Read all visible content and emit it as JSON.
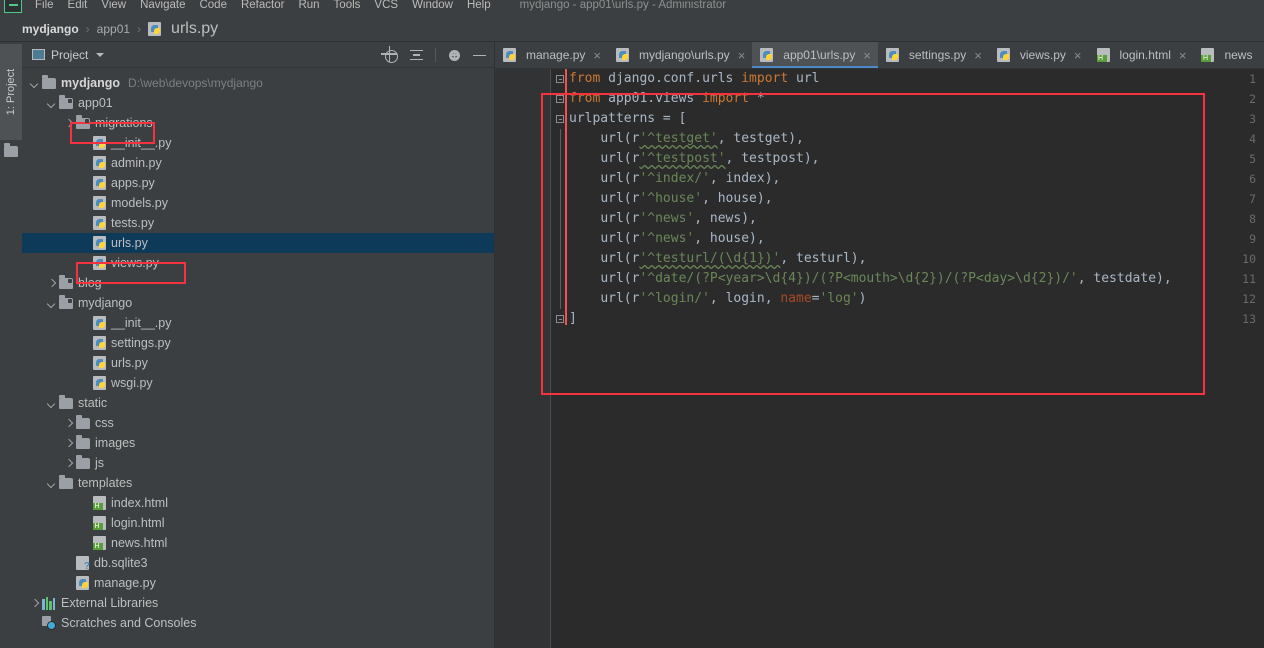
{
  "window": {
    "title": "mydjango - app01\\urls.py - Administrator",
    "app_icon": "pycharm-icon"
  },
  "menubar": {
    "items": [
      "File",
      "Edit",
      "View",
      "Navigate",
      "Code",
      "Refactor",
      "Run",
      "Tools",
      "VCS",
      "Window",
      "Help"
    ]
  },
  "breadcrumb": {
    "root": "mydjango",
    "sep": "›",
    "folder": "app01",
    "file": "urls.py"
  },
  "toolwindow": {
    "left_tab": "1: Project"
  },
  "project_panel": {
    "title": "Project",
    "tools": [
      "locate-icon",
      "collapse-all-icon",
      "settings-gear-icon",
      "minimize-icon"
    ],
    "tree": [
      {
        "indent": 0,
        "arrow": "down",
        "icon": "folder-icon",
        "label": "mydjango",
        "bold": true,
        "path": "D:\\web\\devops\\mydjango",
        "selected": false
      },
      {
        "indent": 1,
        "arrow": "down",
        "icon": "module-folder-icon",
        "label": "app01",
        "bold": false,
        "path": "",
        "selected": false
      },
      {
        "indent": 2,
        "arrow": "right",
        "icon": "module-folder-icon",
        "label": "migrations",
        "bold": false,
        "path": "",
        "selected": false
      },
      {
        "indent": 3,
        "arrow": "none",
        "icon": "python-file-icon",
        "label": "__init__.py",
        "bold": false,
        "path": "",
        "selected": false
      },
      {
        "indent": 3,
        "arrow": "none",
        "icon": "python-file-icon",
        "label": "admin.py",
        "bold": false,
        "path": "",
        "selected": false
      },
      {
        "indent": 3,
        "arrow": "none",
        "icon": "python-file-icon",
        "label": "apps.py",
        "bold": false,
        "path": "",
        "selected": false
      },
      {
        "indent": 3,
        "arrow": "none",
        "icon": "python-file-icon",
        "label": "models.py",
        "bold": false,
        "path": "",
        "selected": false
      },
      {
        "indent": 3,
        "arrow": "none",
        "icon": "python-file-icon",
        "label": "tests.py",
        "bold": false,
        "path": "",
        "selected": false
      },
      {
        "indent": 3,
        "arrow": "none",
        "icon": "python-file-icon",
        "label": "urls.py",
        "bold": false,
        "path": "",
        "selected": true
      },
      {
        "indent": 3,
        "arrow": "none",
        "icon": "python-file-icon",
        "label": "views.py",
        "bold": false,
        "path": "",
        "selected": false
      },
      {
        "indent": 1,
        "arrow": "right",
        "icon": "module-folder-icon",
        "label": "blog",
        "bold": false,
        "path": "",
        "selected": false
      },
      {
        "indent": 1,
        "arrow": "down",
        "icon": "module-folder-icon",
        "label": "mydjango",
        "bold": false,
        "path": "",
        "selected": false
      },
      {
        "indent": 3,
        "arrow": "none",
        "icon": "python-file-icon",
        "label": "__init__.py",
        "bold": false,
        "path": "",
        "selected": false
      },
      {
        "indent": 3,
        "arrow": "none",
        "icon": "python-file-icon",
        "label": "settings.py",
        "bold": false,
        "path": "",
        "selected": false
      },
      {
        "indent": 3,
        "arrow": "none",
        "icon": "python-file-icon",
        "label": "urls.py",
        "bold": false,
        "path": "",
        "selected": false
      },
      {
        "indent": 3,
        "arrow": "none",
        "icon": "python-file-icon",
        "label": "wsgi.py",
        "bold": false,
        "path": "",
        "selected": false
      },
      {
        "indent": 1,
        "arrow": "down",
        "icon": "folder-icon",
        "label": "static",
        "bold": false,
        "path": "",
        "selected": false
      },
      {
        "indent": 2,
        "arrow": "right",
        "icon": "folder-icon",
        "label": "css",
        "bold": false,
        "path": "",
        "selected": false
      },
      {
        "indent": 2,
        "arrow": "right",
        "icon": "folder-icon",
        "label": "images",
        "bold": false,
        "path": "",
        "selected": false
      },
      {
        "indent": 2,
        "arrow": "right",
        "icon": "folder-icon",
        "label": "js",
        "bold": false,
        "path": "",
        "selected": false
      },
      {
        "indent": 1,
        "arrow": "down",
        "icon": "folder-icon",
        "label": "templates",
        "bold": false,
        "path": "",
        "selected": false
      },
      {
        "indent": 3,
        "arrow": "none",
        "icon": "html-file-icon",
        "label": "index.html",
        "bold": false,
        "path": "",
        "selected": false
      },
      {
        "indent": 3,
        "arrow": "none",
        "icon": "html-file-icon",
        "label": "login.html",
        "bold": false,
        "path": "",
        "selected": false
      },
      {
        "indent": 3,
        "arrow": "none",
        "icon": "html-file-icon",
        "label": "news.html",
        "bold": false,
        "path": "",
        "selected": false
      },
      {
        "indent": 2,
        "arrow": "none",
        "icon": "sqlite-db-icon",
        "label": "db.sqlite3",
        "bold": false,
        "path": "",
        "selected": false
      },
      {
        "indent": 2,
        "arrow": "none",
        "icon": "python-file-icon",
        "label": "manage.py",
        "bold": false,
        "path": "",
        "selected": false
      },
      {
        "indent": 0,
        "arrow": "right",
        "icon": "libraries-icon",
        "label": "External Libraries",
        "bold": false,
        "path": "",
        "selected": false
      },
      {
        "indent": 0,
        "arrow": "none",
        "icon": "scratches-icon",
        "label": "Scratches and Consoles",
        "bold": false,
        "path": "",
        "selected": false
      }
    ]
  },
  "editor": {
    "tabs": [
      {
        "label": "manage.py",
        "icon": "python-file-icon",
        "active": false,
        "close": "×"
      },
      {
        "label": "mydjango\\urls.py",
        "icon": "python-file-icon",
        "active": false,
        "close": "×"
      },
      {
        "label": "app01\\urls.py",
        "icon": "python-file-icon",
        "active": true,
        "close": "×"
      },
      {
        "label": "settings.py",
        "icon": "python-file-icon",
        "active": false,
        "close": "×"
      },
      {
        "label": "views.py",
        "icon": "python-file-icon",
        "active": false,
        "close": "×"
      },
      {
        "label": "login.html",
        "icon": "html-file-icon",
        "active": false,
        "close": "×"
      },
      {
        "label": "news",
        "icon": "html-file-icon",
        "active": false,
        "close": ""
      }
    ],
    "line_numbers": [
      "1",
      "2",
      "3",
      "4",
      "5",
      "6",
      "7",
      "8",
      "9",
      "10",
      "11",
      "12",
      "13"
    ],
    "lines": [
      "from django.conf.urls import url",
      "from app01.views import *",
      "urlpatterns = [",
      "    url(r'^testget', testget),",
      "    url(r'^testpost', testpost),",
      "    url(r'^index/', index),",
      "    url(r'^house', house),",
      "    url(r'^news', news),",
      "    url(r'^news', house),",
      "    url(r'^testurl/(\\d{1})', testurl),",
      "    url(r'^date/(?P<year>\\d{4})/(?P<mouth>\\d{2})/(?P<day>\\d{2})/', testdate),",
      "    url(r'^login/', login, name='log')",
      "]"
    ]
  },
  "annotations": {
    "color": "#f5333f",
    "boxes": [
      "app01-folder",
      "urls-py-file",
      "code-block"
    ]
  },
  "colors": {
    "background": "#3c3f41",
    "editor_bg": "#2b2b2b",
    "gutter_bg": "#313335",
    "selection": "#0d3a58",
    "accent": "#4a88c7",
    "keyword": "#cc7832",
    "string": "#6a8759",
    "text": "#a9b7c6",
    "param": "#aa4926",
    "error_stripe": "#ef5350"
  }
}
